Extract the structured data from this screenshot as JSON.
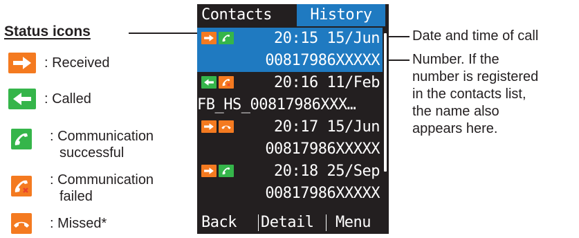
{
  "legend": {
    "title": "Status icons",
    "items": [
      {
        "icon": "received-arrow-icon",
        "label": ": Received"
      },
      {
        "icon": "called-arrow-icon",
        "label": ": Called"
      },
      {
        "icon": "handset-success-icon",
        "label": ": Communication",
        "label2": "successful"
      },
      {
        "icon": "handset-failed-icon",
        "label": ": Communication",
        "label2": "failed"
      },
      {
        "icon": "handset-missed-icon",
        "label": ": Missed*"
      }
    ]
  },
  "screen": {
    "tabs": [
      "Contacts",
      "History"
    ],
    "active_tab": "History",
    "entries": [
      {
        "icons": [
          "received-arrow-icon",
          "handset-success-icon"
        ],
        "datetime": "20:15 15/Jun",
        "number": "00817986XXXXX",
        "selected": true
      },
      {
        "icons": [
          "called-arrow-icon",
          "handset-failed-icon"
        ],
        "datetime": "20:16 11/Feb",
        "number": "FB_HS_00817986XXX…",
        "selected": false
      },
      {
        "icons": [
          "received-arrow-icon",
          "handset-missed-icon"
        ],
        "datetime": "20:17 15/Jun",
        "number": "00817986XXXXX",
        "selected": false
      },
      {
        "icons": [
          "received-arrow-icon",
          "handset-success-icon"
        ],
        "datetime": "20:18 25/Sep",
        "number": "00817986XXXXX",
        "selected": false
      }
    ],
    "softkeys": [
      "Back",
      "Detail",
      "Menu"
    ]
  },
  "annotations": {
    "datetime": "Date and time of call",
    "number_lines": [
      "Number. If the",
      "number is registered",
      "in the contacts list,",
      "the name also",
      "appears here."
    ]
  },
  "colors": {
    "orange": "#f47a20",
    "green": "#35b54a",
    "selected_blue": "#1f7ac1",
    "screen_bg": "#231f20"
  }
}
